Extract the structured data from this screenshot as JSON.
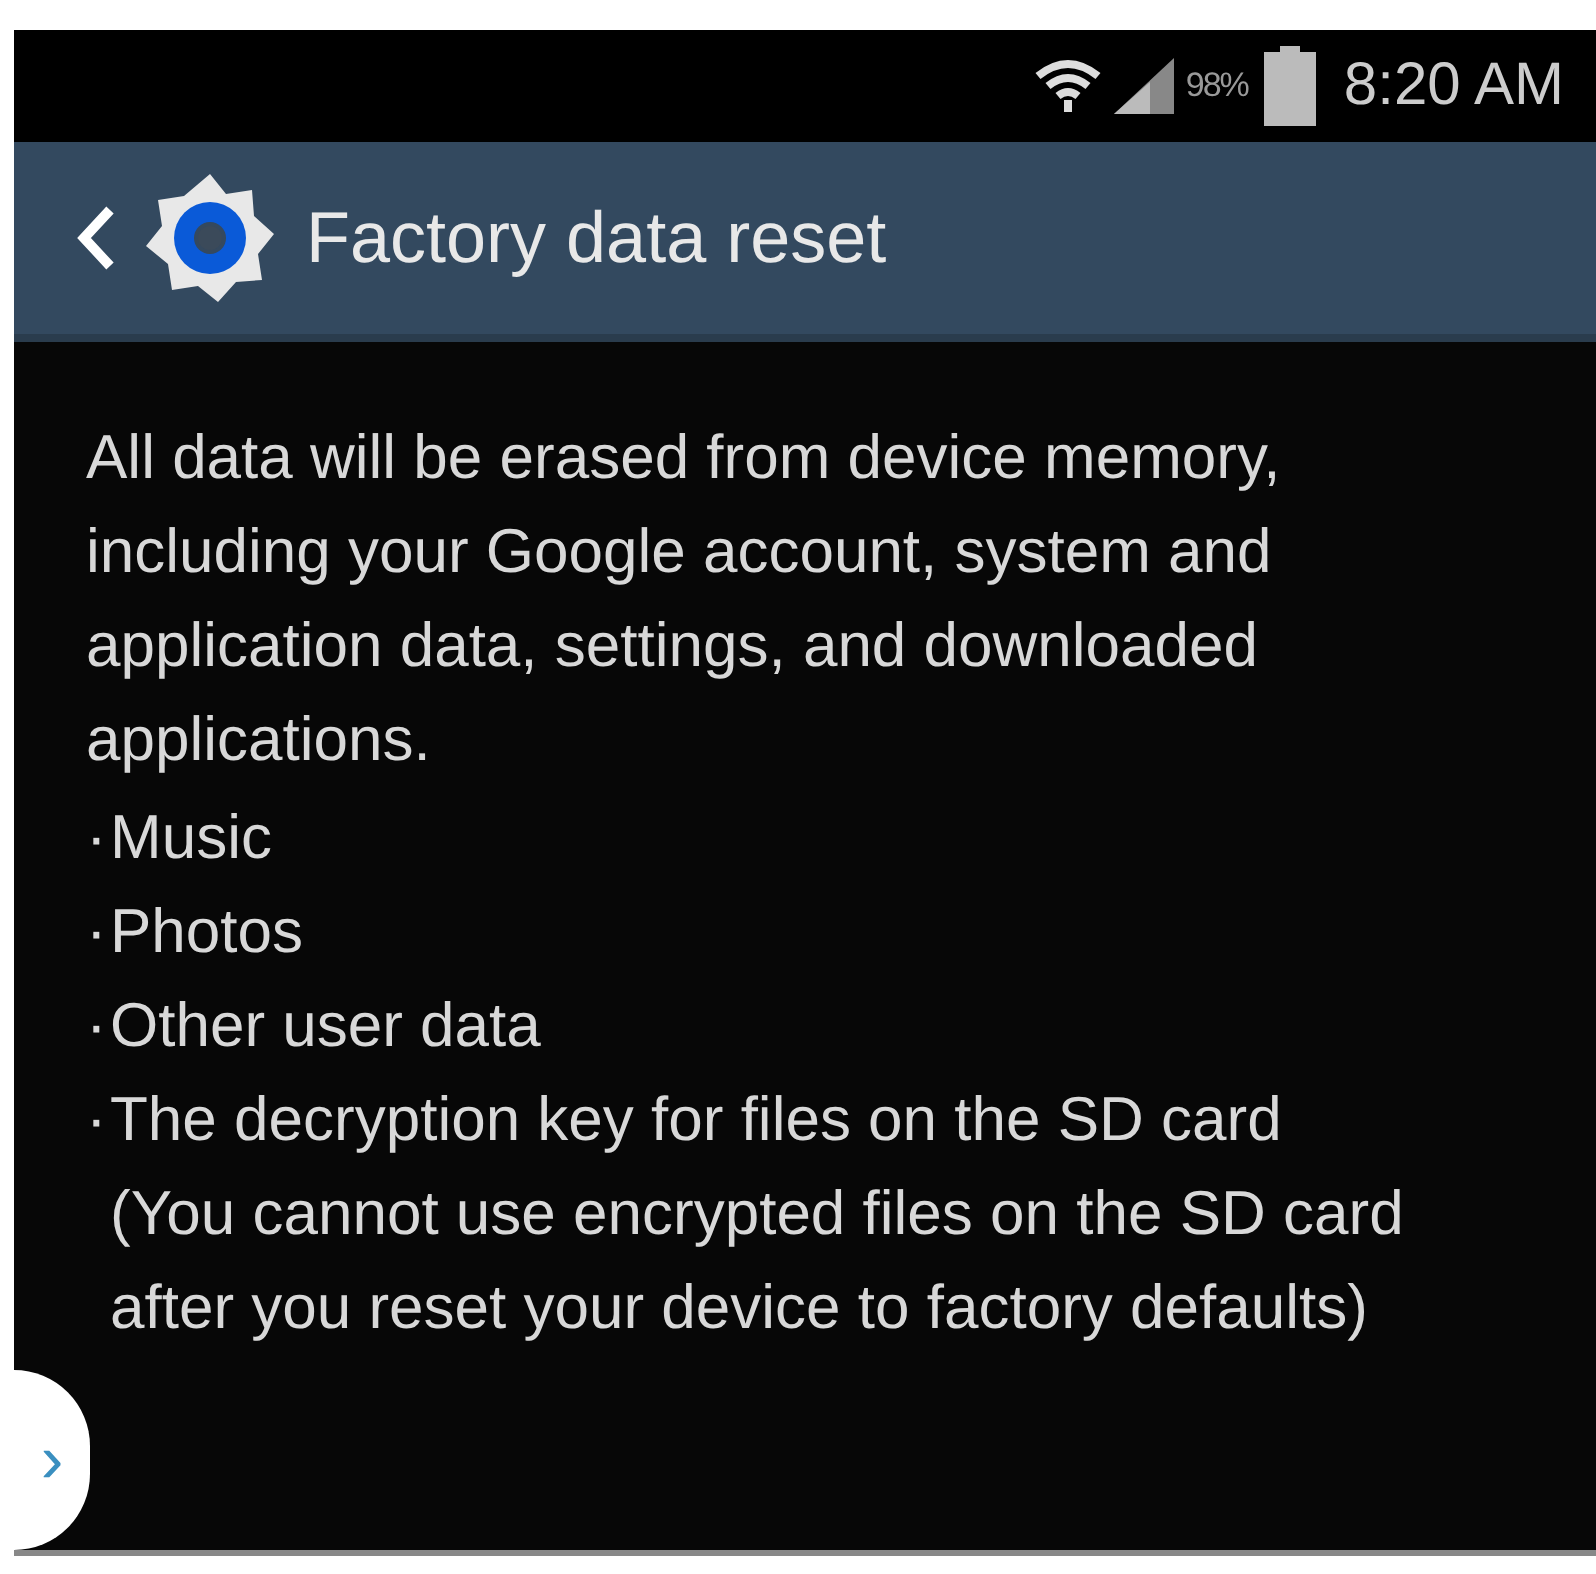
{
  "status_bar": {
    "battery_percent": "98%",
    "time": "8:20 AM"
  },
  "header": {
    "title": "Factory data reset"
  },
  "body": {
    "intro": "All data will be erased from device memory, including your Google account, system and application data, settings, and downloaded applications.",
    "items": [
      {
        "marker": "·",
        "text": "Music"
      },
      {
        "marker": "·",
        "text": "Photos"
      },
      {
        "marker": "·",
        "text": "Other user data"
      },
      {
        "marker": "·",
        "text": "The decryption key for files on the SD card",
        "note": "(You cannot use encrypted files on the SD card after you reset your device to factory defaults)"
      }
    ]
  },
  "side_handle": {
    "glyph": "›"
  }
}
